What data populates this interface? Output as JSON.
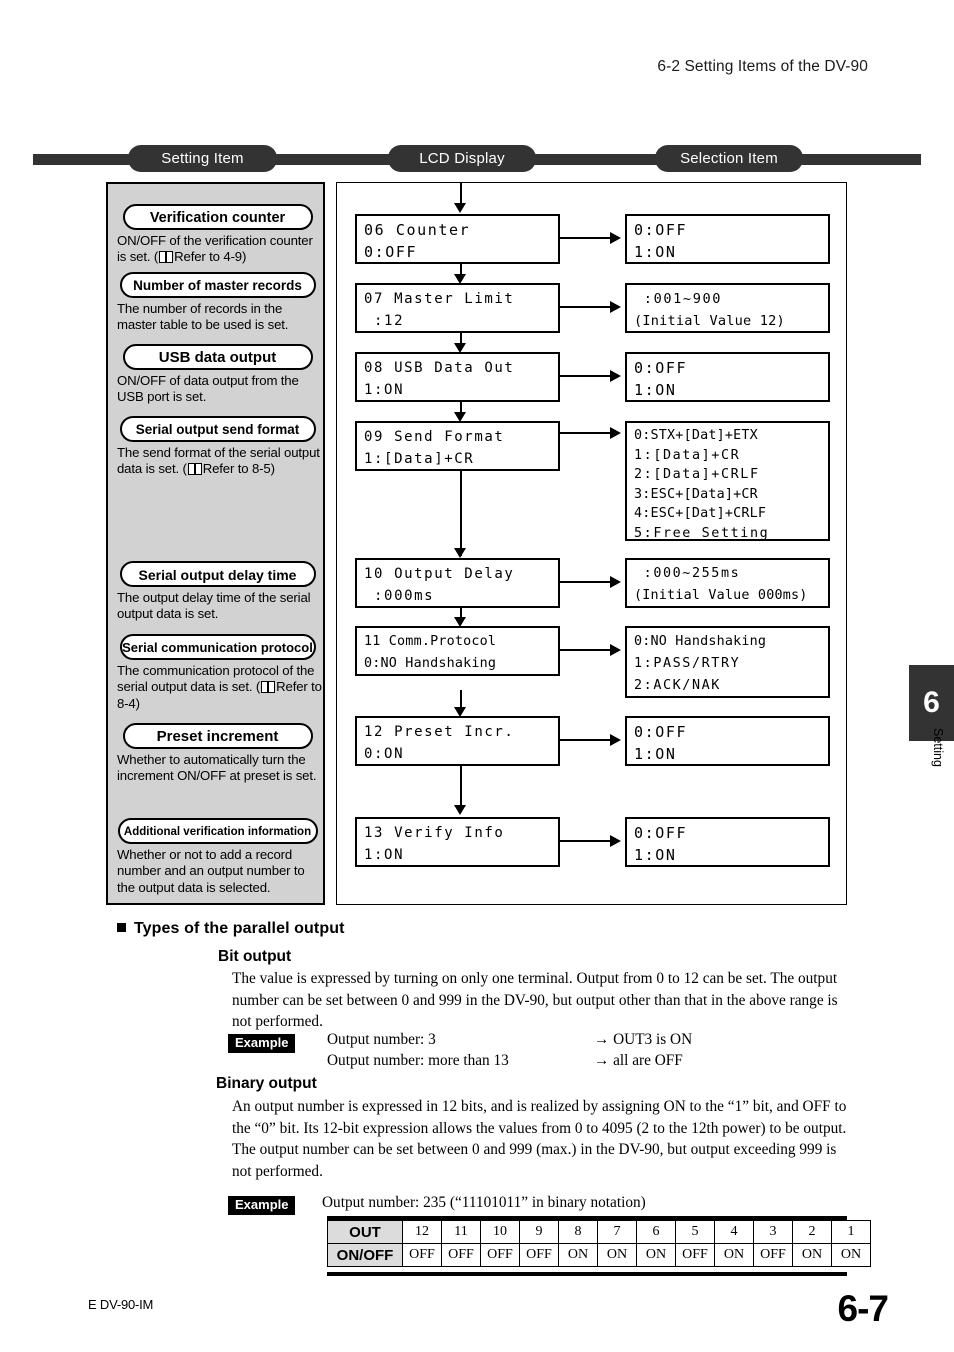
{
  "header": {
    "title": "6-2  Setting Items of the DV-90"
  },
  "captions": {
    "setting_item": "Setting Item",
    "lcd_display": "LCD Display",
    "selection_item": "Selection Item"
  },
  "setting_items": [
    {
      "label": "Verification counter",
      "desc_before": "ON/OFF of the verification counter is set. (",
      "has_book_icon": true,
      "desc_after": "Refer to 4-9)"
    },
    {
      "label": "Number of master records",
      "desc_before": "The number of records in the master table to be used is set.",
      "has_book_icon": false,
      "desc_after": ""
    },
    {
      "label": "USB data output",
      "desc_before": "ON/OFF of data output from the USB port is set.",
      "has_book_icon": false,
      "desc_after": ""
    },
    {
      "label": "Serial output send format",
      "desc_before": "The send format of the serial output data is set. (",
      "has_book_icon": true,
      "desc_after": "Refer to 8-5)"
    },
    {
      "label": "Serial output delay time",
      "desc_before": "The output delay time of the serial output data is set.",
      "has_book_icon": false,
      "desc_after": ""
    },
    {
      "label": "Serial communication protocol",
      "desc_before": "The communication protocol of the serial output data is set. (",
      "has_book_icon": true,
      "desc_after": "Refer to 8-4)"
    },
    {
      "label": "Preset increment",
      "desc_before": "Whether to automatically turn the increment ON/OFF at preset is set.",
      "has_book_icon": false,
      "desc_after": ""
    },
    {
      "label": "Additional verification information",
      "desc_before": "Whether or not to add a record number and an output number to the output data is selected.",
      "has_book_icon": false,
      "desc_after": ""
    }
  ],
  "lcd_screens": [
    {
      "line1": "06 Counter",
      "line2": "0:OFF"
    },
    {
      "line1": "07 Master Limit",
      "line2": " :12"
    },
    {
      "line1": "08 USB Data Out",
      "line2": "1:ON"
    },
    {
      "line1": "09 Send Format",
      "line2": "1:[Data]+CR"
    },
    {
      "line1": "10 Output Delay",
      "line2": " :000ms"
    },
    {
      "line1": "11 Comm.Protocol",
      "line2": "0:NO Handshaking"
    },
    {
      "line1": "12 Preset Incr.",
      "line2": "0:ON"
    },
    {
      "line1": "13 Verify Info",
      "line2": "1:ON"
    }
  ],
  "selection_screens": [
    {
      "lines": [
        "0:OFF",
        "1:ON"
      ]
    },
    {
      "lines": [
        " :001~900",
        "(Initial Value 12)"
      ]
    },
    {
      "lines": [
        "0:OFF",
        "1:ON"
      ]
    },
    {
      "lines": [
        "0:STX+[Dat]+ETX",
        "1:[Data]+CR",
        "2:[Data]+CRLF",
        "3:ESC+[Data]+CR",
        "4:ESC+[Dat]+CRLF",
        "5:Free Setting"
      ]
    },
    {
      "lines": [
        " :000~255ms",
        "(Initial Value 000ms)"
      ]
    },
    {
      "lines": [
        "0:NO Handshaking",
        "1:PASS/RTRY",
        "2:ACK/NAK"
      ]
    },
    {
      "lines": [
        "0:OFF",
        "1:ON"
      ]
    },
    {
      "lines": [
        "0:OFF",
        "1:ON"
      ]
    }
  ],
  "parallel_output": {
    "heading": "Types of the parallel output",
    "bit": {
      "heading": "Bit output",
      "paragraph": "The value is expressed by turning on only one terminal. Output from 0 to 12 can be set. The output number can be set between 0 and 999 in the DV-90, but output other than that in the above range is not performed.",
      "example_badge": "Example",
      "examples": [
        {
          "left": "Output number: 3",
          "right": "→ OUT3 is ON"
        },
        {
          "left": "Output number: more than 13",
          "right": "→ all are OFF"
        }
      ]
    },
    "binary": {
      "heading": "Binary output",
      "paragraph": "An output number is expressed in 12 bits, and is realized by assigning ON to the “1” bit, and OFF to the “0” bit. Its 12-bit expression allows the values from 0 to 4095 (2 to the 12th power) to be output. The output number can be set between 0 and 999 (max.) in the DV-90, but output exceeding 999 is not performed.",
      "example_badge": "Example",
      "example_caption": "Output number: 235 (“11101011” in binary notation)",
      "table": {
        "row_headers": [
          "OUT",
          "ON/OFF"
        ],
        "out": [
          "12",
          "11",
          "10",
          "9",
          "8",
          "7",
          "6",
          "5",
          "4",
          "3",
          "2",
          "1"
        ],
        "onoff": [
          "OFF",
          "OFF",
          "OFF",
          "OFF",
          "ON",
          "ON",
          "ON",
          "OFF",
          "ON",
          "OFF",
          "ON",
          "ON"
        ]
      }
    }
  },
  "chapter_tab": {
    "number": "6",
    "label": "Setting"
  },
  "footer": {
    "doc_id": "E DV-90-IM",
    "page": "6-7"
  },
  "colors": {
    "rule": "#333333",
    "panel_gray": "#d2d2d2",
    "table_head_gray": "#dcdcdc"
  }
}
